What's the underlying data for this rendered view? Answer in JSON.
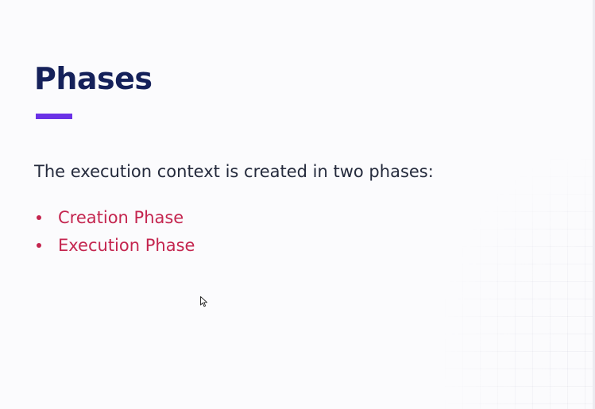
{
  "slide": {
    "title": "Phases",
    "intro": "The execution context is created in two phases:",
    "phases": [
      {
        "label": "Creation Phase"
      },
      {
        "label": "Execution Phase"
      }
    ]
  },
  "colors": {
    "title": "#15215a",
    "accent_bar": "#6a31e6",
    "body_text": "#242a3c",
    "list_text": "#c4254f",
    "background": "#fbfbfd"
  },
  "icons": {
    "cursor": "mouse-pointer-icon"
  }
}
